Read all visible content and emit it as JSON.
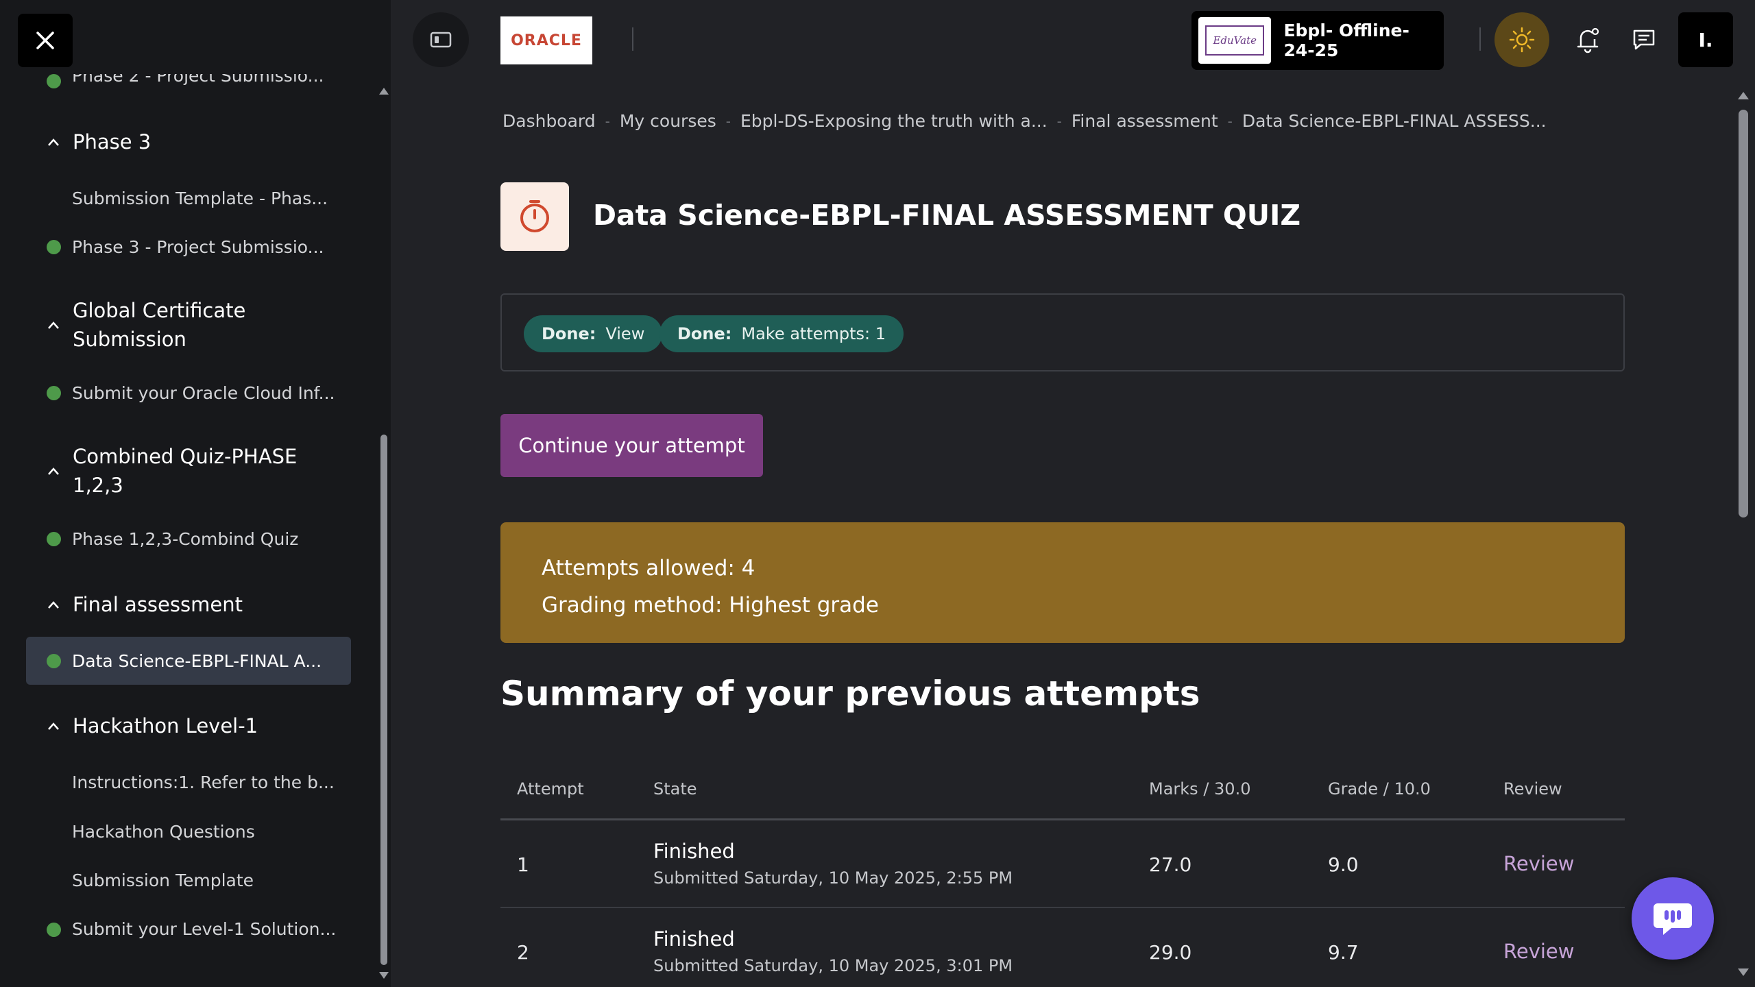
{
  "sidebar": {
    "cut_item": "Phase 2 - Project Submissio...",
    "sections": [
      {
        "title": "Phase 3",
        "items": [
          {
            "label": "Submission Template - Phas...",
            "done": false
          },
          {
            "label": "Phase 3 - Project Submissio...",
            "done": true
          }
        ]
      },
      {
        "title": "Global Certificate Submission",
        "items": [
          {
            "label": "Submit your Oracle Cloud Inf...",
            "done": true
          }
        ]
      },
      {
        "title": "Combined Quiz-PHASE 1,2,3",
        "items": [
          {
            "label": "Phase 1,2,3-Combind Quiz",
            "done": true
          }
        ]
      },
      {
        "title": "Final assessment",
        "items": [
          {
            "label": "Data Science-EBPL-FINAL A...",
            "done": true,
            "active": true
          }
        ]
      },
      {
        "title": "Hackathon Level-1",
        "items": [
          {
            "label": "Instructions:1. Refer to the b...",
            "done": false
          },
          {
            "label": "Hackathon Questions",
            "done": false
          },
          {
            "label": "Submission Template",
            "done": false
          },
          {
            "label": "Submit your Level-1 Solution...",
            "done": true
          }
        ]
      }
    ]
  },
  "topbar": {
    "brand_logo_text": "ORACLE",
    "org_logo_text": "EduVate",
    "org_name": "Ebpl- Offline- 24-25",
    "user_initial": "I."
  },
  "breadcrumb": [
    "Dashboard",
    "My courses",
    "Ebpl-DS-Exposing the truth with a...",
    "Final assessment",
    "Data Science-EBPL-FINAL ASSESS..."
  ],
  "page": {
    "title": "Data Science-EBPL-FINAL ASSESSMENT QUIZ",
    "completion": [
      {
        "status": "Done:",
        "label": "View"
      },
      {
        "status": "Done:",
        "label": "Make attempts: 1"
      }
    ],
    "continue_label": "Continue your attempt",
    "attempts_allowed": "Attempts allowed: 4",
    "grading_method": "Grading method: Highest grade",
    "summary_heading": "Summary of your previous attempts"
  },
  "table": {
    "headers": {
      "attempt": "Attempt",
      "state": "State",
      "marks": "Marks / 30.0",
      "grade": "Grade / 10.0",
      "review": "Review"
    },
    "rows": [
      {
        "attempt": "1",
        "state": "Finished",
        "submitted": "Submitted Saturday, 10 May 2025, 2:55 PM",
        "marks": "27.0",
        "grade": "9.0",
        "review": "Review"
      },
      {
        "attempt": "2",
        "state": "Finished",
        "submitted": "Submitted Saturday, 10 May 2025, 3:01 PM",
        "marks": "29.0",
        "grade": "9.7",
        "review": "Review"
      }
    ]
  },
  "colors": {
    "background": "#212226",
    "sidebar": "#17181b",
    "done_dot": "#4e9a4a",
    "pill": "#1f5e56",
    "primary_button": "#7a3b7f",
    "info_box": "#8d6923",
    "oracle_red": "#c74634",
    "chat_fab": "#6e58e8"
  },
  "icons": {
    "close": "close-icon",
    "drawer": "sidebar-toggle-icon",
    "theme": "sun-icon",
    "notifications": "bell-icon",
    "messages": "chat-bubble-icon",
    "quiz": "stopwatch-icon",
    "chat_fab": "chatbot-icon"
  }
}
